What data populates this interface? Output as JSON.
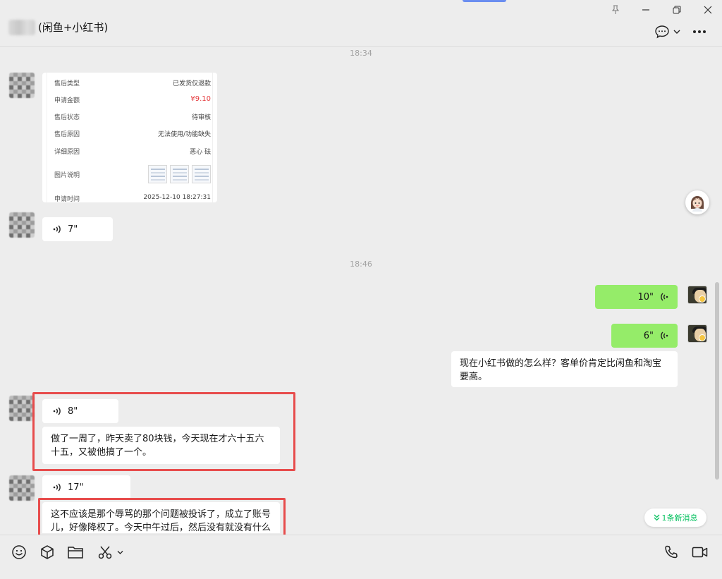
{
  "header": {
    "chat_title": "(闲鱼+小红书)"
  },
  "timestamps": [
    "18:34",
    "18:46"
  ],
  "order_card": {
    "rows": [
      {
        "label": "售后类型",
        "value": "已发货仅退款"
      },
      {
        "label": "申请金额",
        "value": "¥9.10"
      },
      {
        "label": "售后状态",
        "value": "待审核"
      },
      {
        "label": "售后原因",
        "value": "无法使用/功能缺失"
      },
      {
        "label": "详细原因",
        "value": "恶心 砝"
      },
      {
        "label": "图片说明",
        "value": ""
      },
      {
        "label": "申请时间",
        "value": "2025-12-10 18:27:31"
      }
    ]
  },
  "messages": {
    "voice_1": "7\"",
    "self_voice_1": "10\"",
    "self_voice_2": "6\"",
    "self_text": "现在小红书做的怎么样？客单价肯定比闲鱼和淘宝要高。",
    "voice_2": "8\"",
    "text_1": "做了一周了，昨天卖了80块钱，今天现在才六十五六十五，又被他搞了一个。",
    "voice_3": "17\"",
    "text_2": "这不应该是那个辱骂的那个问题被投诉了，成立了账号儿，好像降权了。今天中午过后，然后没有就没有什么"
  },
  "new_message_badge": "1条新消息",
  "icons": {
    "pin": "pin-icon",
    "minimize": "minimize-icon",
    "restore": "restore-icon",
    "close": "close-icon",
    "chat": "chat-bubble-icon",
    "more": "more-icon",
    "emoji": "emoji-icon",
    "box": "package-icon",
    "folder": "folder-icon",
    "scissors": "scissors-icon",
    "phone": "phone-icon",
    "video": "video-icon"
  },
  "colors": {
    "background": "#ededed",
    "self_bubble": "#95ec69",
    "highlight": "#e74c4c",
    "amount": "#e4393c",
    "new_msg": "#07c160"
  }
}
